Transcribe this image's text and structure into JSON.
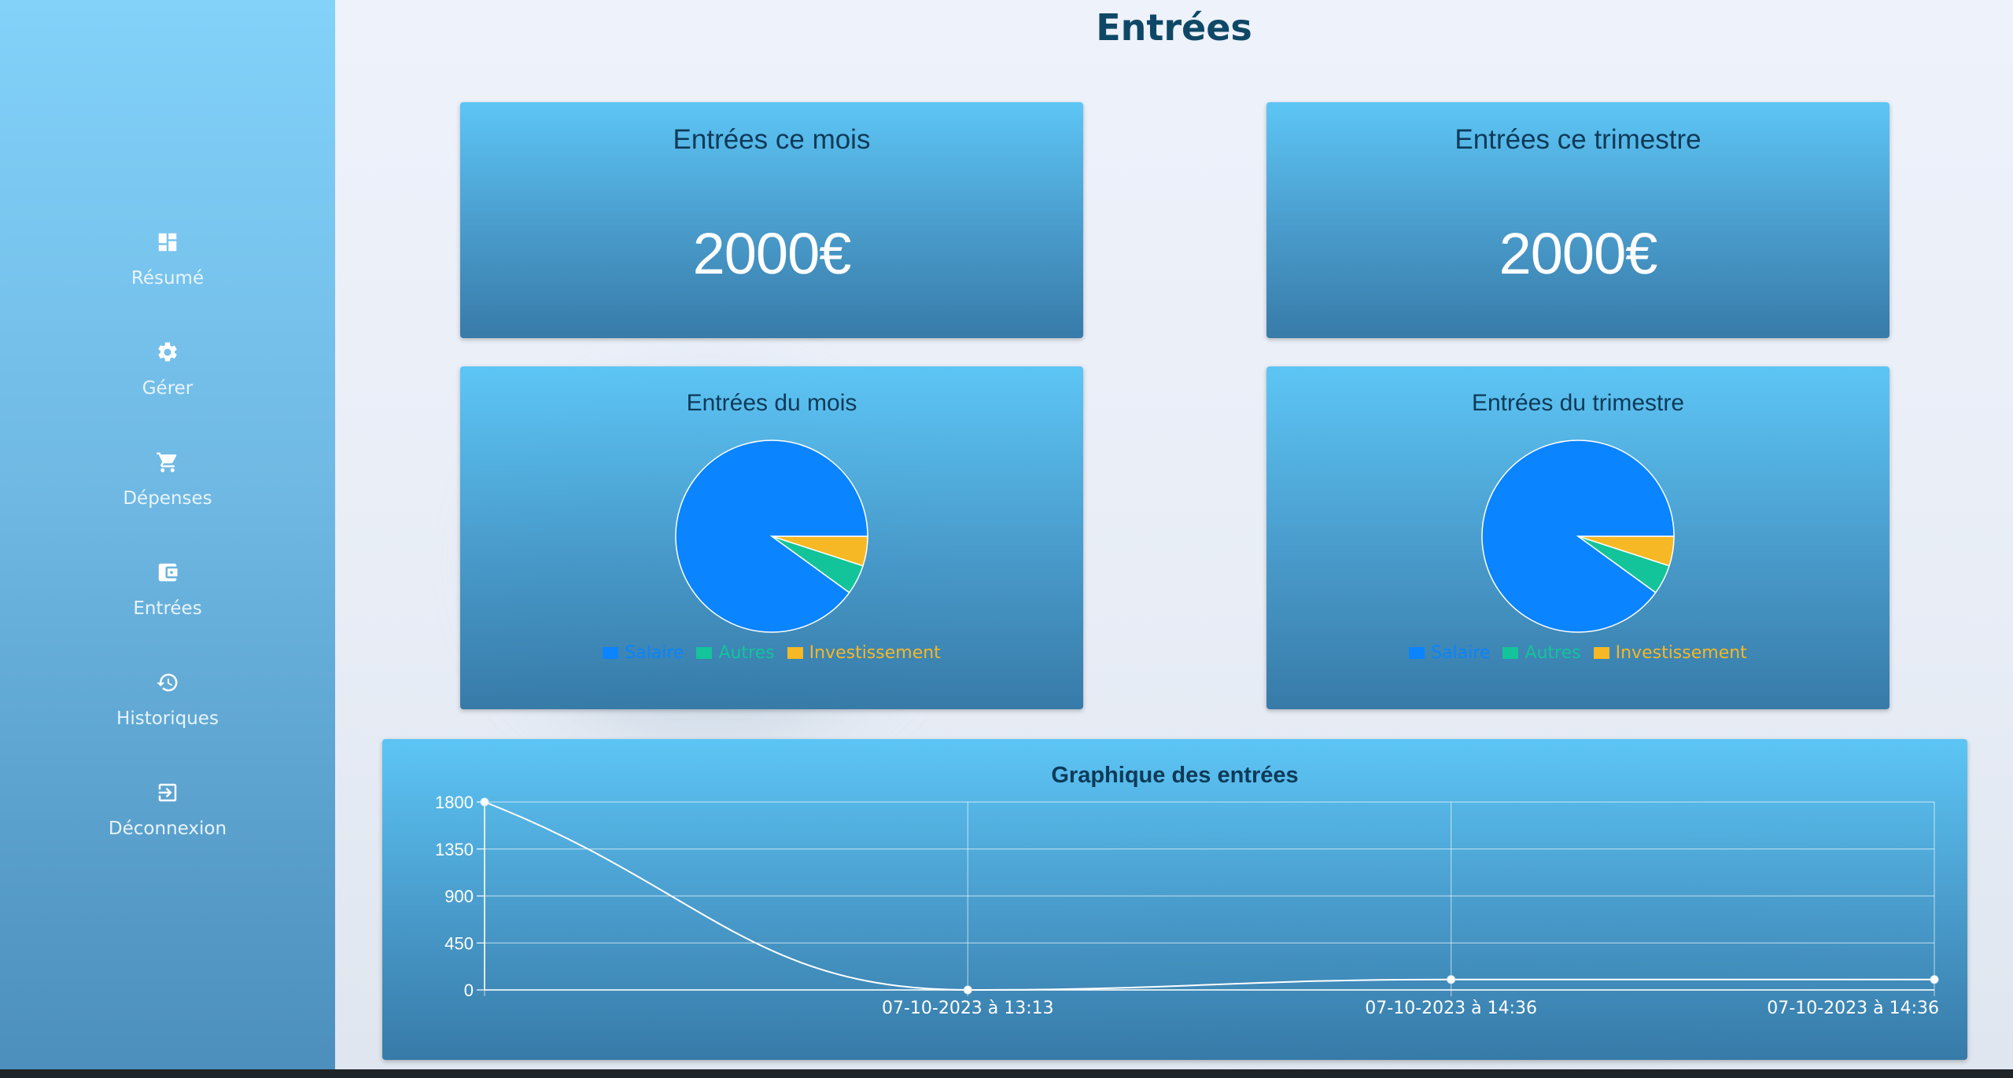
{
  "sidebar": {
    "items": [
      {
        "label": "Résumé",
        "icon": "dashboard-icon"
      },
      {
        "label": "Gérer",
        "icon": "gear-icon"
      },
      {
        "label": "Dépenses",
        "icon": "cart-icon"
      },
      {
        "label": "Entrées",
        "icon": "wallet-icon"
      },
      {
        "label": "Historiques",
        "icon": "history-icon"
      },
      {
        "label": "Déconnexion",
        "icon": "logout-icon"
      }
    ]
  },
  "page": {
    "title": "Entrées"
  },
  "stats": {
    "month": {
      "title": "Entrées ce mois",
      "value": "2000€"
    },
    "quarter": {
      "title": "Entrées ce trimestre",
      "value": "2000€"
    }
  },
  "colors": {
    "salaire": "#0a84ff",
    "autres": "#13c49a",
    "investissement": "#f6b824",
    "title_dark": "#0f4866"
  },
  "chart_data": [
    {
      "type": "pie",
      "title": "Entrées du mois",
      "labels": [
        "Salaire",
        "Autres",
        "Investissement"
      ],
      "values": [
        90,
        5,
        5
      ]
    },
    {
      "type": "pie",
      "title": "Entrées du trimestre",
      "labels": [
        "Salaire",
        "Autres",
        "Investissement"
      ],
      "values": [
        90,
        5,
        5
      ]
    },
    {
      "type": "line",
      "title": "Graphique des entrées",
      "x": [
        "",
        "07-10-2023 à 13:13",
        "07-10-2023 à 14:36",
        "07-10-2023 à 14:36"
      ],
      "series": [
        {
          "values": [
            1800,
            0,
            100,
            100
          ]
        }
      ],
      "yticks": [
        0,
        450,
        900,
        1350,
        1800
      ],
      "ylim": [
        0,
        1800
      ],
      "grid": true
    }
  ]
}
